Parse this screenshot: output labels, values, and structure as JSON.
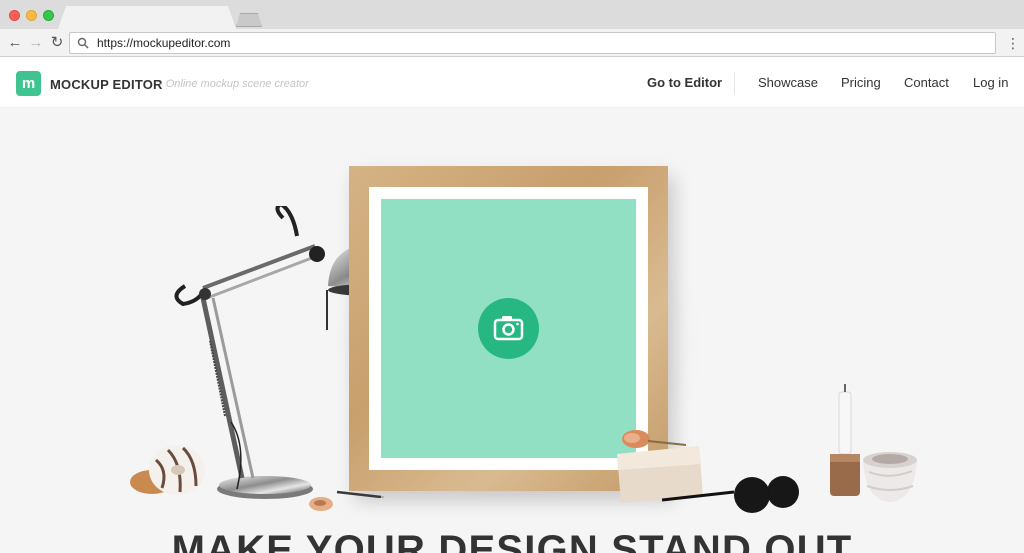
{
  "browser": {
    "url": "https://mockupeditor.com"
  },
  "header": {
    "logo_letter": "m",
    "brand": "MOCKUP EDITOR",
    "tagline": "- Online mockup scene creator",
    "nav": {
      "go_to_editor": "Go to Editor",
      "showcase": "Showcase",
      "pricing": "Pricing",
      "contact": "Contact",
      "login": "Log in"
    }
  },
  "hero": {
    "headline": "MAKE YOUR DESIGN STAND OUT"
  },
  "colors": {
    "brand": "#3fc390",
    "picture_placeholder": "#92e0c4",
    "camera_button": "#26b783"
  },
  "icons": {
    "camera": "camera-icon",
    "search": "search-icon"
  }
}
